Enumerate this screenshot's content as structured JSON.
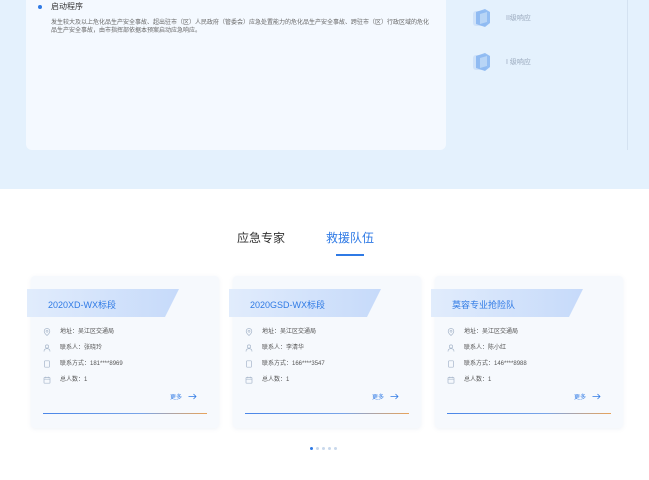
{
  "procedure": {
    "title": "启动程序",
    "body": "发生较大及以上危化品生产安全事故、超出驻市（区）人民政府（管委会）应急处置能力的危化品生产安全事故、跨驻市（区）行政区域的危化品生产安全事故，由市指挥部依据本预案启动应急响应。"
  },
  "levels": [
    {
      "label": "II级响应"
    },
    {
      "label": "I 级响应"
    }
  ],
  "tabs": [
    {
      "label": "应急专家"
    },
    {
      "label": "救援队伍"
    }
  ],
  "teams": [
    {
      "name": "2020XD-WX标段",
      "address": "地址：吴江区交通局",
      "contact": "联系人：张晓玲",
      "phone": "联系方式：181****8969",
      "count": "总人数：1",
      "more": "更多"
    },
    {
      "name": "2020GSD-WX标段",
      "address": "地址：吴江区交通局",
      "contact": "联系人：李清华",
      "phone": "联系方式：166****3547",
      "count": "总人数：1",
      "more": "更多"
    },
    {
      "name": "莫容专业抢险队",
      "address": "地址：吴江区交通局",
      "contact": "联系人：陈小红",
      "phone": "联系方式：146****8988",
      "count": "总人数：1",
      "more": "更多"
    }
  ],
  "icons": {
    "level": "shield-cube-icon",
    "address": "location-pin-icon",
    "contact": "person-icon",
    "phone": "phone-icon",
    "count": "calendar-icon",
    "more": "arrow-right-icon"
  },
  "colors": {
    "accent": "#2f7ae5",
    "band": "#e4f1fd"
  },
  "pager": {
    "pages": 5,
    "active_index": 0
  }
}
